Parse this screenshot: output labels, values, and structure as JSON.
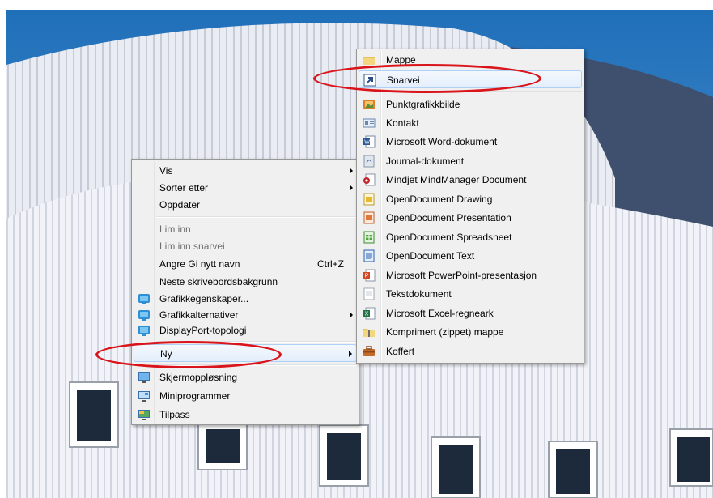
{
  "context_menu": {
    "items": [
      {
        "label": "Vis",
        "submenu": true
      },
      {
        "label": "Sorter etter",
        "submenu": true
      },
      {
        "label": "Oppdater"
      },
      {
        "label": "Lim inn",
        "disabled": true
      },
      {
        "label": "Lim inn snarvei",
        "disabled": true
      },
      {
        "label": "Angre Gi nytt navn",
        "shortcut": "Ctrl+Z"
      },
      {
        "label": "Neste skrivebordsbakgrunn"
      },
      {
        "label": "Grafikkegenskaper...",
        "icon": "intel-graphics-icon"
      },
      {
        "label": "Grafikkalternativer",
        "icon": "intel-graphics-icon",
        "submenu": true
      },
      {
        "label": "DisplayPort-topologi",
        "icon": "intel-graphics-icon"
      },
      {
        "label": "Ny",
        "submenu": true,
        "highlighted": true
      },
      {
        "label": "Skjermoppløsning",
        "icon": "display-icon"
      },
      {
        "label": "Miniprogrammer",
        "icon": "gadgets-icon"
      },
      {
        "label": "Tilpass",
        "icon": "personalize-icon"
      }
    ]
  },
  "new_submenu": {
    "items": [
      {
        "label": "Mappe",
        "icon": "folder-icon"
      },
      {
        "label": "Snarvei",
        "icon": "shortcut-icon",
        "highlighted": true
      },
      {
        "label": "Punktgrafikkbilde",
        "icon": "bitmap-icon"
      },
      {
        "label": "Kontakt",
        "icon": "contact-icon"
      },
      {
        "label": "Microsoft Word-dokument",
        "icon": "word-icon"
      },
      {
        "label": "Journal-dokument",
        "icon": "journal-icon"
      },
      {
        "label": "Mindjet MindManager Document",
        "icon": "mindmanager-icon"
      },
      {
        "label": "OpenDocument Drawing",
        "icon": "odg-icon"
      },
      {
        "label": "OpenDocument Presentation",
        "icon": "odp-icon"
      },
      {
        "label": "OpenDocument Spreadsheet",
        "icon": "ods-icon"
      },
      {
        "label": "OpenDocument Text",
        "icon": "odt-icon"
      },
      {
        "label": "Microsoft PowerPoint-presentasjon",
        "icon": "powerpoint-icon"
      },
      {
        "label": "Tekstdokument",
        "icon": "text-document-icon"
      },
      {
        "label": "Microsoft Excel-regneark",
        "icon": "excel-icon"
      },
      {
        "label": "Komprimert (zippet) mappe",
        "icon": "zip-folder-icon"
      },
      {
        "label": "Koffert",
        "icon": "briefcase-icon"
      }
    ]
  },
  "annotation_color": "#d9141b"
}
